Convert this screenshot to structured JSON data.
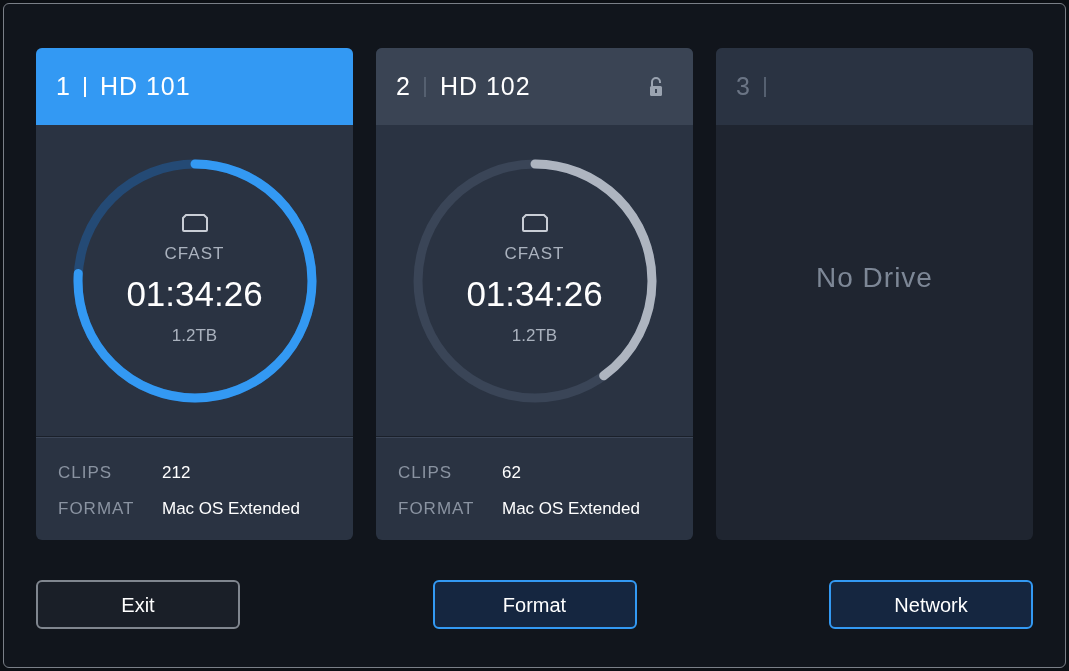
{
  "slots": [
    {
      "kind": "drive",
      "number": "1",
      "name": "HD 101",
      "selected": true,
      "unlocked": false,
      "media": "CFAST",
      "time": "01:34:26",
      "capacity": "1.2TB",
      "level": 0.76,
      "info": [
        {
          "label": "CLIPS",
          "value": "212"
        },
        {
          "label": "FORMAT",
          "value": "Mac OS Extended"
        }
      ]
    },
    {
      "kind": "drive",
      "number": "2",
      "name": "HD 102",
      "selected": false,
      "unlocked": true,
      "media": "CFAST",
      "time": "01:34:26",
      "capacity": "1.2TB",
      "level": 0.4,
      "info": [
        {
          "label": "CLIPS",
          "value": "62"
        },
        {
          "label": "FORMAT",
          "value": "Mac OS Extended"
        }
      ]
    },
    {
      "kind": "empty",
      "number": "3",
      "selected": false,
      "message": "No Drive"
    }
  ],
  "buttons": [
    {
      "label": "Exit",
      "kind": "plain"
    },
    {
      "label": "Format",
      "kind": "accent"
    },
    {
      "label": "Network",
      "kind": "accent"
    }
  ]
}
